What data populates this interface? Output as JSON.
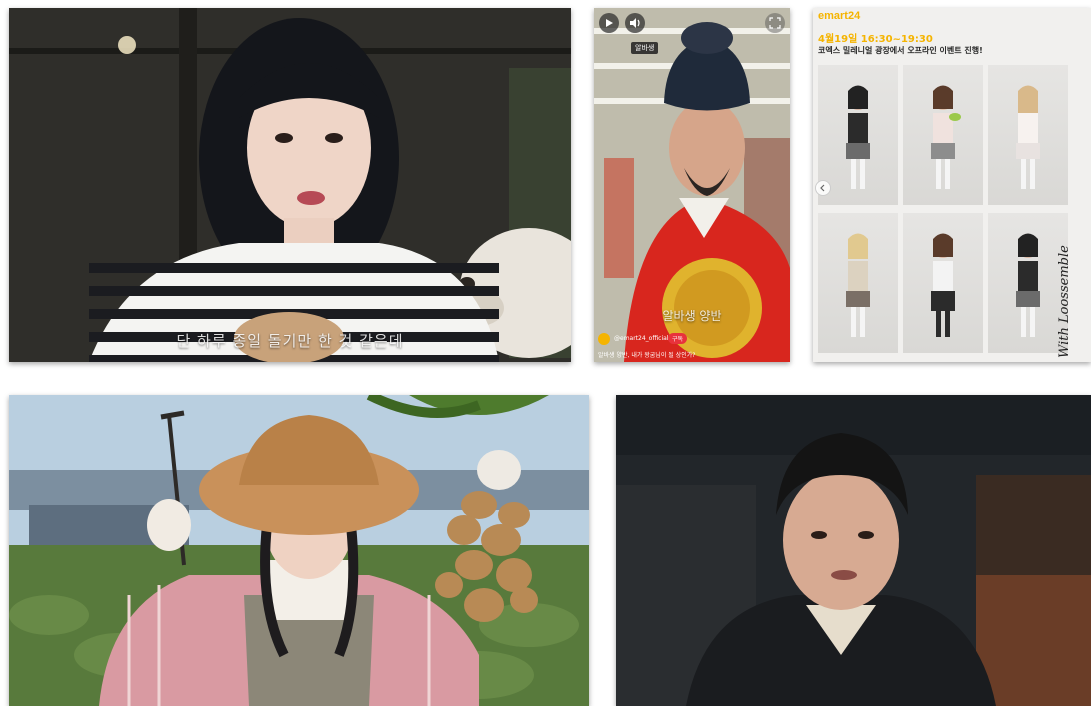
{
  "tile1": {
    "subtitle": "단 하루 종일 돌기만 한 것 같은데"
  },
  "tile2": {
    "name_tag": "알바생",
    "caption_overlay": "알바생 양반",
    "account": "@emart24_official",
    "follow_label": "구독",
    "description": "알바생 양반, 내가 왕굼님이 될 상인가?"
  },
  "tile3": {
    "brand": "emart24",
    "date_line": "4월19일 16:30~19:30",
    "event_line": "코엑스 밀레니얼 광장에서 오프라인 이벤트 진행!",
    "side_text": "With Loossemble"
  },
  "colors": {
    "emart_yellow": "#f5b400",
    "follow_red": "#e8323c"
  }
}
